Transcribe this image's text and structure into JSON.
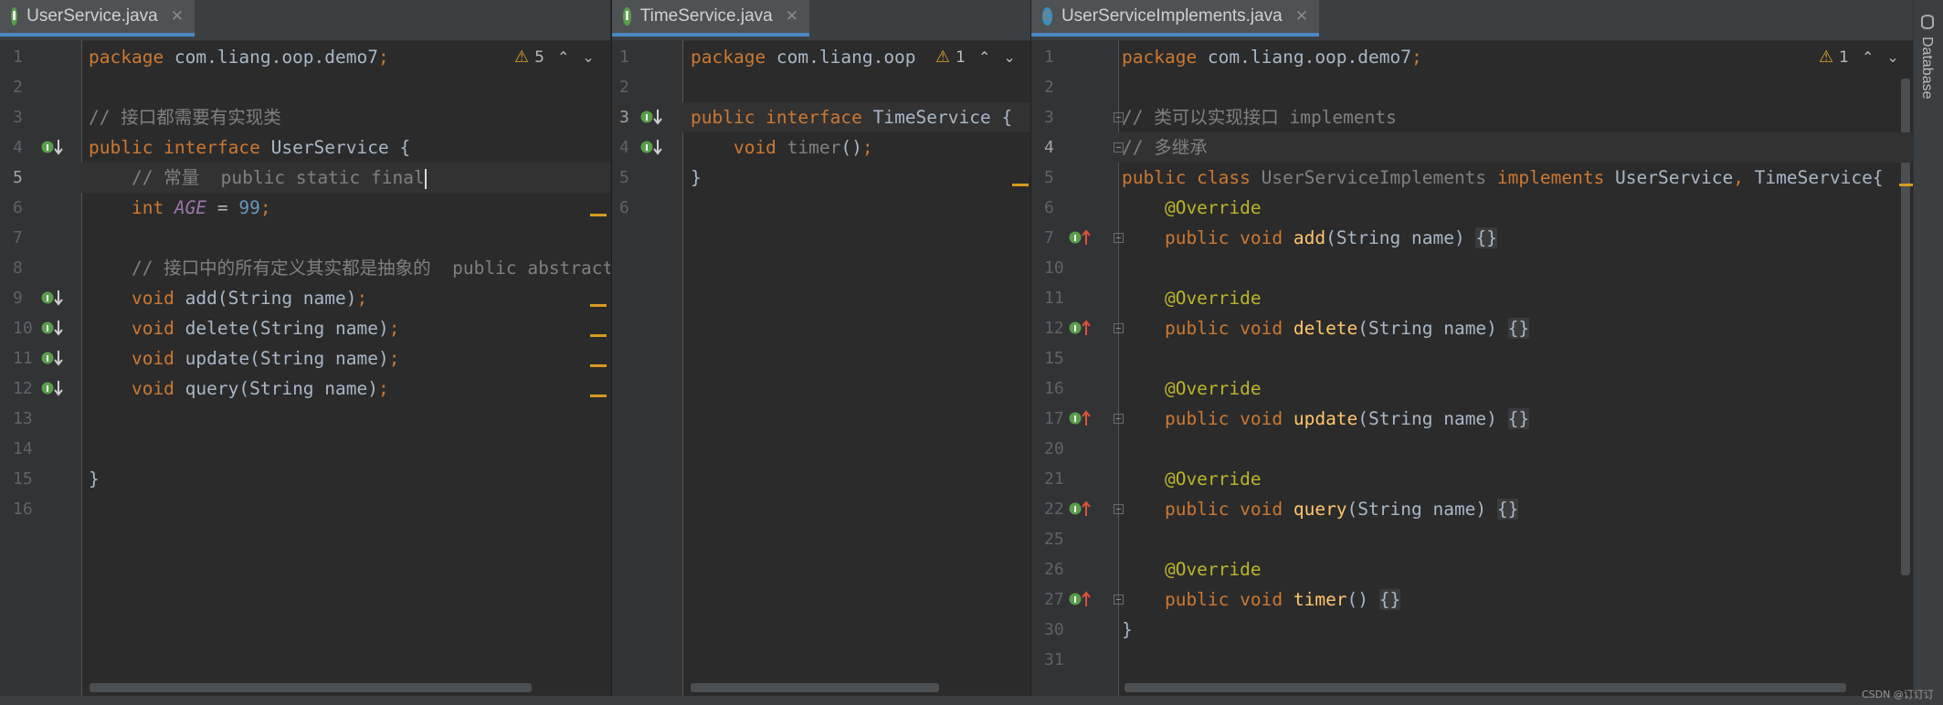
{
  "panes": [
    {
      "tab": {
        "name": "UserService.java",
        "icon": "I",
        "icon_type": "interface-icon"
      },
      "warning": {
        "count": "5"
      },
      "current_line": "5",
      "lines": [
        {
          "num": "1",
          "tokens": [
            [
              "k",
              "package "
            ],
            [
              "",
              "com.liang.oop.demo7"
            ],
            [
              "k",
              ";"
            ]
          ]
        },
        {
          "num": "2",
          "tokens": []
        },
        {
          "num": "3",
          "tokens": [
            [
              "c",
              "// 接口都需要有实现类"
            ]
          ]
        },
        {
          "num": "4",
          "tokens": [
            [
              "k",
              "public interface "
            ],
            [
              "",
              "UserService {"
            ]
          ]
        },
        {
          "num": "5",
          "tokens": [
            [
              "c",
              "    // 常量  public static final"
            ],
            [
              "caret",
              ""
            ]
          ]
        },
        {
          "num": "6",
          "tokens": [
            [
              "k",
              "    int "
            ],
            [
              "it",
              "AGE"
            ],
            [
              "",
              " = "
            ],
            [
              "n",
              "99"
            ],
            [
              "k",
              ";"
            ]
          ]
        },
        {
          "num": "7",
          "tokens": []
        },
        {
          "num": "8",
          "tokens": [
            [
              "c",
              "    // 接口中的所有定义其实都是抽象的  public abstract"
            ]
          ]
        },
        {
          "num": "9",
          "tokens": [
            [
              "k",
              "    void "
            ],
            [
              "",
              "add(String name)"
            ],
            [
              "k",
              ";"
            ]
          ]
        },
        {
          "num": "10",
          "tokens": [
            [
              "k",
              "    void "
            ],
            [
              "",
              "delete(String name)"
            ],
            [
              "k",
              ";"
            ]
          ]
        },
        {
          "num": "11",
          "tokens": [
            [
              "k",
              "    void "
            ],
            [
              "",
              "update(String name)"
            ],
            [
              "k",
              ";"
            ]
          ]
        },
        {
          "num": "12",
          "tokens": [
            [
              "k",
              "    void "
            ],
            [
              "",
              "query(String name)"
            ],
            [
              "k",
              ";"
            ]
          ]
        },
        {
          "num": "13",
          "tokens": []
        },
        {
          "num": "14",
          "tokens": []
        },
        {
          "num": "15",
          "tokens": [
            [
              "",
              "}"
            ]
          ]
        },
        {
          "num": "16",
          "tokens": []
        }
      ]
    },
    {
      "tab": {
        "name": "TimeService.java",
        "icon": "I",
        "icon_type": "interface-icon"
      },
      "warning": {
        "count": "1"
      },
      "current_line": "3",
      "lines": [
        {
          "num": "1",
          "tokens": [
            [
              "k",
              "package "
            ],
            [
              "",
              "com.liang.oop"
            ]
          ]
        },
        {
          "num": "2",
          "tokens": []
        },
        {
          "num": "3",
          "tokens": [
            [
              "k",
              "public interface "
            ],
            [
              "",
              "TimeService {"
            ]
          ]
        },
        {
          "num": "4",
          "tokens": [
            [
              "k",
              "    void "
            ],
            [
              "g",
              "timer"
            ],
            [
              "",
              "()"
            ],
            [
              "k",
              ";"
            ]
          ]
        },
        {
          "num": "5",
          "tokens": [
            [
              "",
              "}"
            ]
          ]
        },
        {
          "num": "6",
          "tokens": []
        }
      ]
    },
    {
      "tab": {
        "name": "UserServiceImplements.java",
        "icon": "C",
        "icon_type": "class-icon"
      },
      "warning": {
        "count": "1"
      },
      "current_line": "4",
      "lines": [
        {
          "num": "1",
          "tokens": [
            [
              "k",
              "package "
            ],
            [
              "",
              "com.liang.oop.demo7"
            ],
            [
              "k",
              ";"
            ]
          ]
        },
        {
          "num": "2",
          "tokens": []
        },
        {
          "num": "3",
          "tokens": [
            [
              "c",
              "// 类可以实现接口 implements"
            ]
          ]
        },
        {
          "num": "4",
          "tokens": [
            [
              "c",
              "// 多继承"
            ]
          ]
        },
        {
          "num": "5",
          "tokens": [
            [
              "k",
              "public class "
            ],
            [
              "g",
              "UserServiceImplements "
            ],
            [
              "k",
              "implements "
            ],
            [
              "",
              "UserService"
            ],
            [
              "k",
              ", "
            ],
            [
              "",
              "TimeService{"
            ]
          ]
        },
        {
          "num": "6",
          "tokens": [
            [
              "a",
              "    @Override"
            ]
          ]
        },
        {
          "num": "7",
          "tokens": [
            [
              "k",
              "    public void "
            ],
            [
              "f",
              "add"
            ],
            [
              "",
              "(String name) "
            ],
            [
              "br",
              "{}"
            ]
          ]
        },
        {
          "num": "10",
          "tokens": []
        },
        {
          "num": "11",
          "tokens": [
            [
              "a",
              "    @Override"
            ]
          ]
        },
        {
          "num": "12",
          "tokens": [
            [
              "k",
              "    public void "
            ],
            [
              "f",
              "delete"
            ],
            [
              "",
              "(String name) "
            ],
            [
              "br",
              "{}"
            ]
          ]
        },
        {
          "num": "15",
          "tokens": []
        },
        {
          "num": "16",
          "tokens": [
            [
              "a",
              "    @Override"
            ]
          ]
        },
        {
          "num": "17",
          "tokens": [
            [
              "k",
              "    public void "
            ],
            [
              "f",
              "update"
            ],
            [
              "",
              "(String name) "
            ],
            [
              "br",
              "{}"
            ]
          ]
        },
        {
          "num": "20",
          "tokens": []
        },
        {
          "num": "21",
          "tokens": [
            [
              "a",
              "    @Override"
            ]
          ]
        },
        {
          "num": "22",
          "tokens": [
            [
              "k",
              "    public void "
            ],
            [
              "f",
              "query"
            ],
            [
              "",
              "(String name) "
            ],
            [
              "br",
              "{}"
            ]
          ]
        },
        {
          "num": "25",
          "tokens": []
        },
        {
          "num": "26",
          "tokens": [
            [
              "a",
              "    @Override"
            ]
          ]
        },
        {
          "num": "27",
          "tokens": [
            [
              "k",
              "    public void "
            ],
            [
              "f",
              "timer"
            ],
            [
              "",
              "() "
            ],
            [
              "br",
              "{}"
            ]
          ]
        },
        {
          "num": "30",
          "tokens": [
            [
              "",
              "}"
            ]
          ]
        },
        {
          "num": "31",
          "tokens": []
        }
      ]
    }
  ],
  "sidebar": {
    "database_label": "Database"
  },
  "watermark": "CSDN @订订订"
}
